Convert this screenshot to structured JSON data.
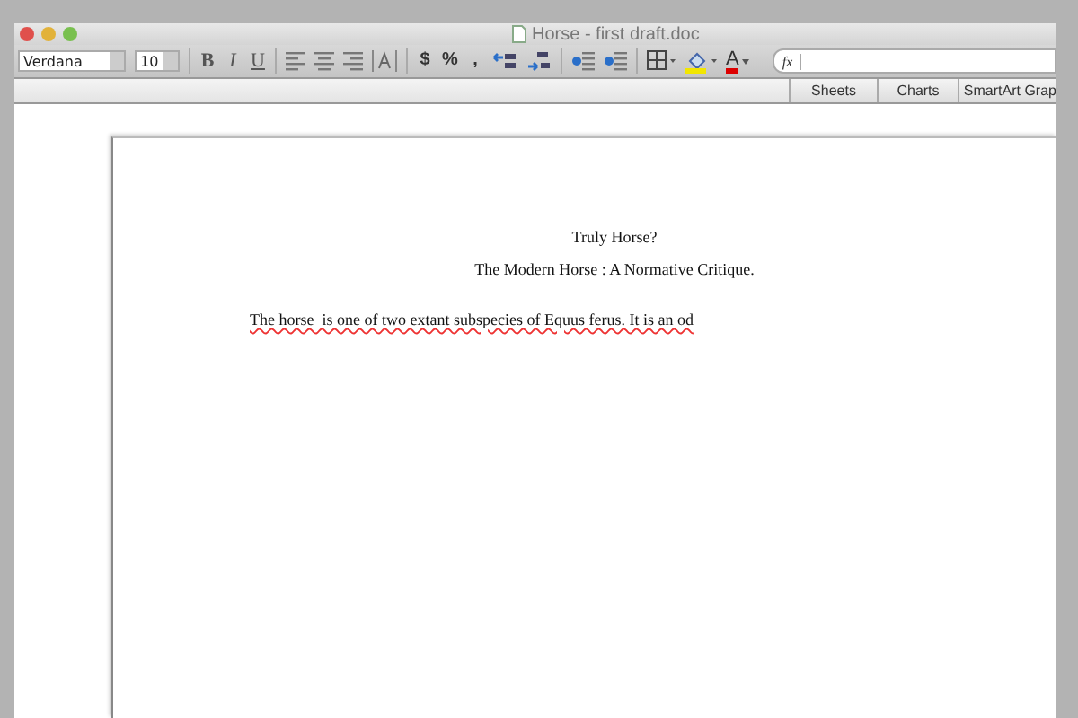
{
  "window": {
    "title": "Horse - first draft.doc"
  },
  "toolbar": {
    "font_name": "Verdana",
    "font_size": "10",
    "format_buttons": [
      "B",
      "I",
      "U"
    ],
    "number_buttons": [
      "$",
      "%",
      ","
    ],
    "font_color_label": "A",
    "formula_label": "fx"
  },
  "gallery_tabs": [
    {
      "label": "Sheets"
    },
    {
      "label": "Charts"
    },
    {
      "label": "SmartArt Grap"
    }
  ],
  "document": {
    "title": "Truly Horse?",
    "subtitle": "The Modern Horse : A Normative Critique.",
    "body_text": "The horse  is one of two extant subspecies of Equus ferus. It is an od"
  }
}
